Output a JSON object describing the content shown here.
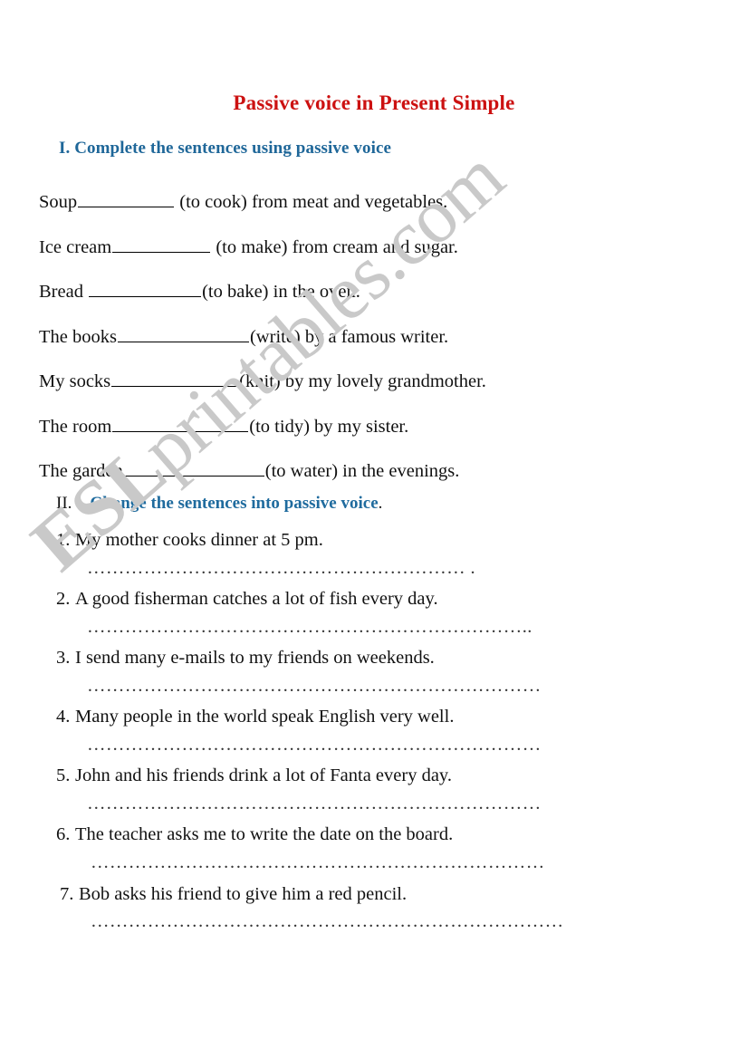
{
  "document": {
    "title": "Passive voice in Present Simple",
    "title_color": "#cc1111",
    "heading_color": "#1f6799"
  },
  "watermark": {
    "bold_part": "ESL",
    "rest_part": "printables.com",
    "color": "#c9c9c9"
  },
  "section_one": {
    "number": "I.",
    "heading": "Complete the sentences using passive voice",
    "heading_full": "I. Complete the sentences using passive voice",
    "items": [
      {
        "before": "Soup",
        "blank_width": 106,
        "after": " (to cook) from meat and vegetables."
      },
      {
        "before": "Ice cream",
        "blank_width": 108,
        "after": " (to make) from cream and sugar."
      },
      {
        "before": "Bread ",
        "blank_width": 124,
        "after": "(to bake) in the oven."
      },
      {
        "before": "The books",
        "blank_width": 145,
        "after": "(write) by a famous writer."
      },
      {
        "before": "My socks",
        "blank_width": 140,
        "after": "(knit) by my lovely grandmother."
      },
      {
        "before": "The room",
        "blank_width": 150,
        "after": "(to tidy) by my sister."
      },
      {
        "before": "The garden",
        "blank_width": 155,
        "after": "(to water) in the evenings."
      }
    ]
  },
  "section_two": {
    "number": "II.",
    "heading": "Change the sentences into passive voice",
    "heading_period": ".",
    "questions": [
      {
        "num": "1.",
        "text": "My mother cooks dinner at 5 pm.",
        "dots": "…………………………………………………… .",
        "dots_indent": 34
      },
      {
        "num": "2.",
        "text": "A good fisherman catches a lot of fish every day.",
        "dots": "……………………………………………………………..",
        "dots_indent": 34
      },
      {
        "num": "3.",
        "text": "I send many e-mails to my friends on weekends.",
        "dots": "………………………………………………………………",
        "dots_indent": 34
      },
      {
        "num": "4.",
        "text": "Many people in the world speak English very well.",
        "dots": "………………………………………………………………",
        "dots_indent": 34
      },
      {
        "num": "5.",
        "text": "John and his friends drink a lot of Fanta every day.",
        "dots": "………………………………………………………………",
        "dots_indent": 34
      },
      {
        "num": "6.",
        "text": "The teacher asks me to write the date on the board.",
        "dots": "………………………………………………………………",
        "dots_indent": 38
      },
      {
        "num": "7.",
        "text": "Bob asks his friend to give him a red pencil.",
        "dots": "…………………………………………………………………",
        "dots_indent": 38
      }
    ]
  }
}
